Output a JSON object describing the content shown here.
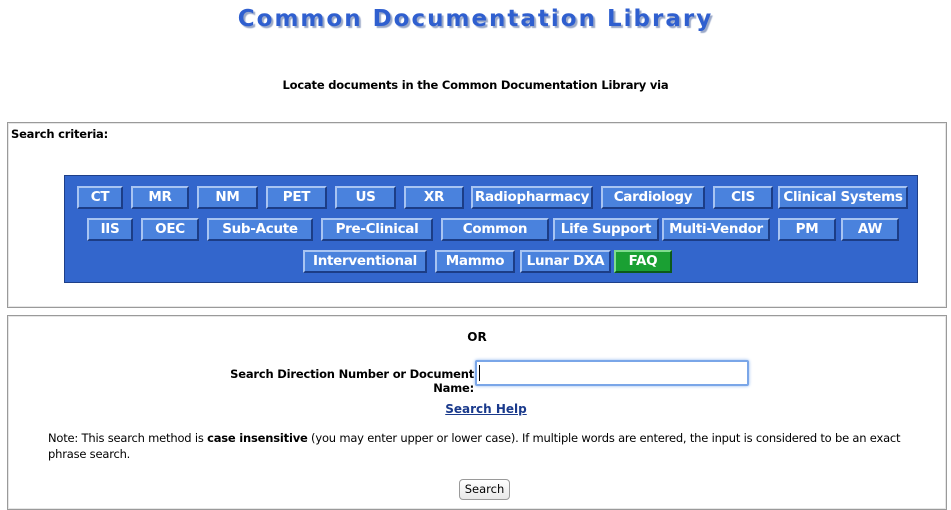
{
  "header": {
    "title": "Common Documentation Library",
    "subtitle": "Locate documents in the Common Documentation Library via"
  },
  "criteria": {
    "label": "Search criteria:",
    "rows": [
      [
        {
          "label": "CT"
        },
        {
          "label": "MR"
        },
        {
          "label": "NM"
        },
        {
          "label": "PET"
        },
        {
          "label": "US"
        },
        {
          "label": "XR"
        },
        {
          "label": "Radiopharmacy"
        },
        {
          "label": "Cardiology"
        },
        {
          "label": "CIS"
        },
        {
          "label": "Clinical Systems"
        }
      ],
      [
        {
          "label": "IIS"
        },
        {
          "label": "OEC"
        },
        {
          "label": "Sub-Acute"
        },
        {
          "label": "Pre-Clinical"
        },
        {
          "label": "Common"
        },
        {
          "label": "Life Support"
        },
        {
          "label": "Multi-Vendor"
        },
        {
          "label": "PM"
        },
        {
          "label": "AW"
        }
      ],
      [
        {
          "label": "Interventional"
        },
        {
          "label": "Mammo"
        },
        {
          "label": "Lunar DXA"
        },
        {
          "label": "FAQ",
          "color": "#1aa033"
        }
      ]
    ],
    "button_color": "#4a82dd",
    "panel_color": "#3366cc"
  },
  "search": {
    "or_label": "OR",
    "label": "Search Direction Number or Document Name:",
    "value": "",
    "help_link": "Search Help",
    "note_before": "Note: This search method is ",
    "note_bold": "case insensitive",
    "note_after": " (you may enter upper or lower case). If multiple words are entered, the input is considered to be an exact phrase search.",
    "button": "Search"
  }
}
